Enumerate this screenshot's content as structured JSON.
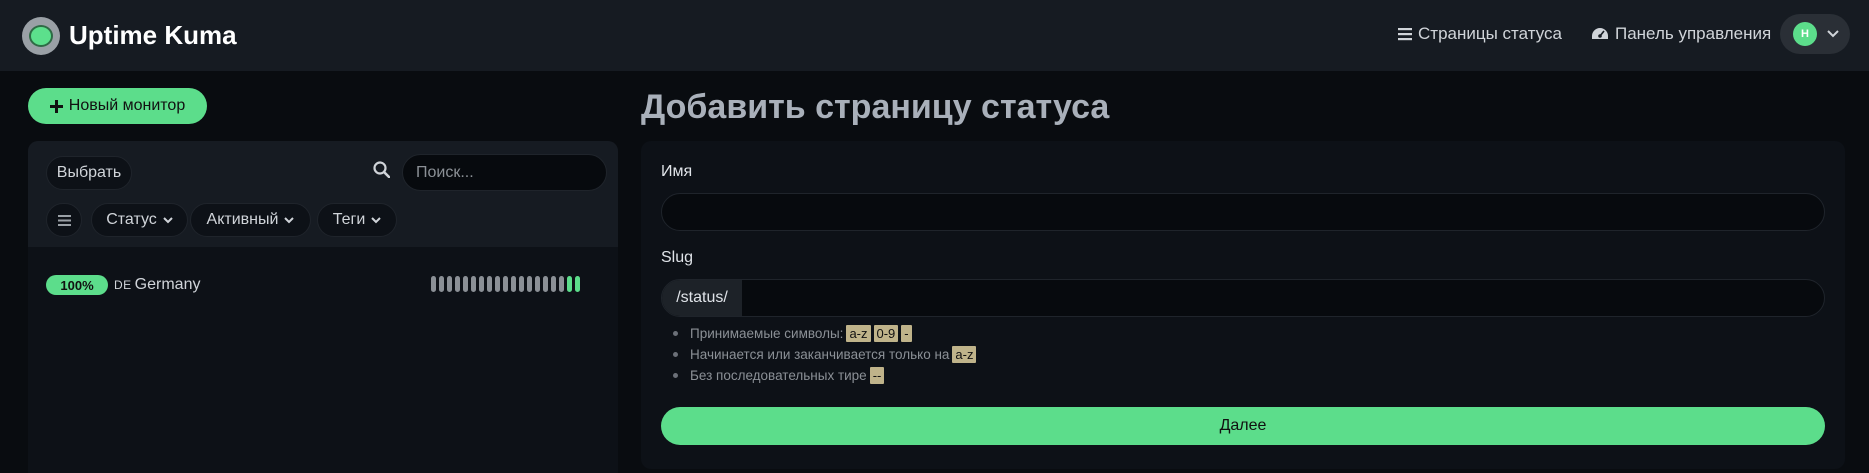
{
  "header": {
    "brand": "Uptime Kuma",
    "nav_status_pages": "Страницы статуса",
    "nav_dashboard": "Панель управления",
    "user_initial": "H"
  },
  "sidebar": {
    "new_monitor_label": "Новый монитор",
    "select_label": "Выбрать",
    "search_placeholder": "Поиск...",
    "filters": {
      "status": "Статус",
      "active": "Активный",
      "tags": "Теги"
    },
    "monitors": [
      {
        "uptime": "100%",
        "flag": "DE",
        "name": "Germany",
        "beats": [
          "down",
          "down",
          "down",
          "down",
          "down",
          "down",
          "down",
          "down",
          "down",
          "down",
          "down",
          "down",
          "down",
          "down",
          "down",
          "down",
          "down",
          "up",
          "up"
        ]
      }
    ]
  },
  "main": {
    "title": "Добавить страницу статуса",
    "name_label": "Имя",
    "name_value": "",
    "slug_label": "Slug",
    "slug_prefix": "/status/",
    "slug_value": "",
    "rules": {
      "allowed_text": "Принимаемые символы:",
      "allowed_codes": [
        "a-z",
        "0-9",
        "-"
      ],
      "start_end_text": "Начинается или заканчивается только на",
      "start_end_code": "a-z",
      "no_consecutive_text": "Без последовательных тире",
      "no_consecutive_code": "--"
    },
    "next_label": "Далее"
  },
  "colors": {
    "accent": "#5cdd8b",
    "background": "#090c10",
    "header": "#161b22",
    "card": "#0d1117",
    "code_bg": "#bfb38a"
  },
  "icons": [
    "status-list-icon",
    "dashboard-gauge-icon",
    "chevron-down-icon",
    "plus-icon",
    "search-icon",
    "hamburger-icon"
  ]
}
